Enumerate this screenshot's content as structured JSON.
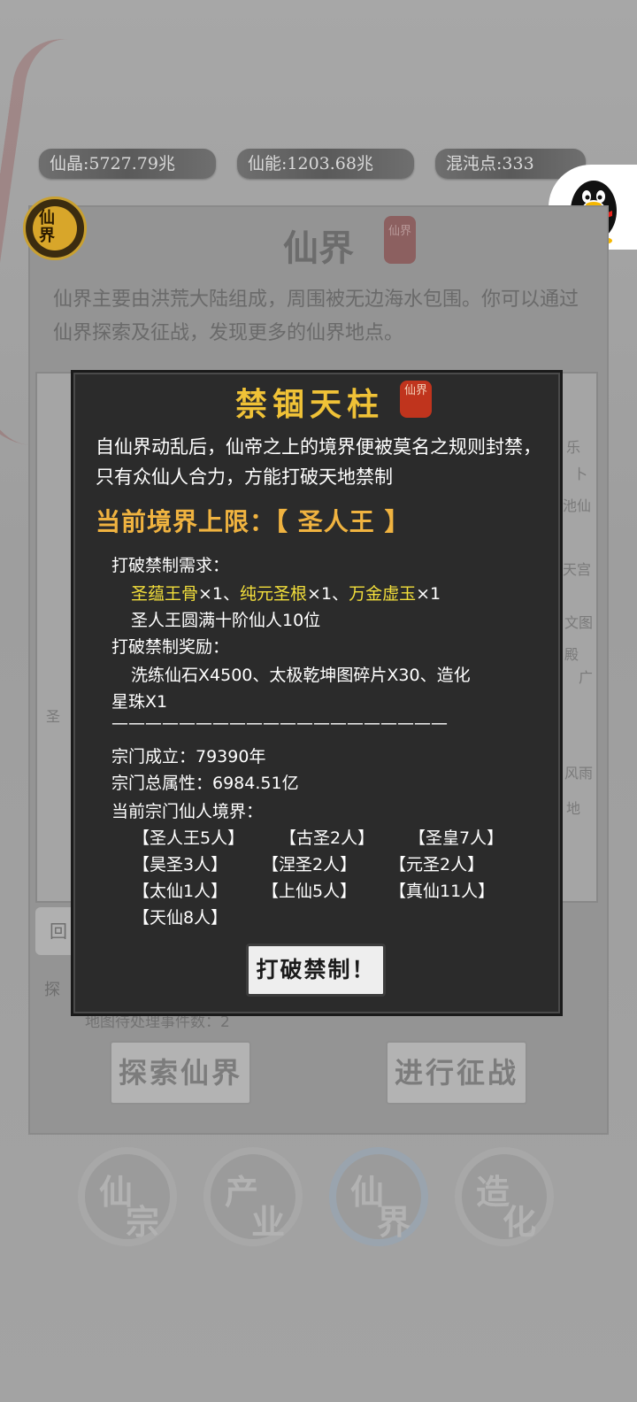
{
  "resources": {
    "xianjing": "仙晶:5727.79兆",
    "xianneng": "仙能:1203.68兆",
    "hundun": "混沌点:333"
  },
  "badge": {
    "label": "仙界"
  },
  "panel": {
    "title": "仙界",
    "seal": "仙界",
    "description": "仙界主要由洪荒大陆组成，周围被无边海水包围。你可以通过仙界探索及征战，发现更多的仙界地点。",
    "map_side_texts": [
      "乐",
      "卜",
      "池仙",
      "天宫",
      "文图",
      "殿",
      "广",
      "风雨",
      "地"
    ],
    "map_left_text": "圣",
    "back_label": "回",
    "explore_label": "探",
    "events_label": "地图待处理事件数：2",
    "explore_button": "探索仙界",
    "war_button": "进行征战"
  },
  "nav": {
    "items": [
      {
        "label_a": "仙",
        "label_b": "宗"
      },
      {
        "label_a": "产",
        "label_b": "业"
      },
      {
        "label_a": "仙",
        "label_b": "界"
      },
      {
        "label_a": "造",
        "label_b": "化"
      }
    ]
  },
  "modal": {
    "title": "禁锢天柱",
    "seal": "仙界",
    "lore": "自仙界动乱后，仙帝之上的境界便被莫名之规则封禁，只有众仙人合力，方能打破天地禁制",
    "realm_cap": "当前境界上限：【 圣人王 】",
    "req_header": "打破禁制需求：",
    "req_items": [
      {
        "name": "圣蕴王骨",
        "qty": "×1、"
      },
      {
        "name": "纯元圣根",
        "qty": "×1、"
      },
      {
        "name": "万金虚玉",
        "qty": "×1"
      }
    ],
    "req_line2": "圣人王圆满十阶仙人10位",
    "reward_header": "打破禁制奖励：",
    "reward_line1": "洗练仙石X4500、太极乾坤图碎片X30、造化",
    "reward_line2": "星珠X1",
    "divider": "————————————————————",
    "sect_founded": "宗门成立：79390年",
    "sect_attr": "宗门总属性：6984.51亿",
    "sect_realm_header": "当前宗门仙人境界：",
    "realm_tags": [
      "【圣人王5人】",
      "【古圣2人】",
      "【圣皇7人】",
      "【昊圣3人】",
      "【涅圣2人】",
      "【元圣2人】",
      "【太仙1人】",
      "【上仙5人】",
      "【真仙11人】",
      "【天仙8人】"
    ],
    "break_button": "打破禁制！"
  }
}
